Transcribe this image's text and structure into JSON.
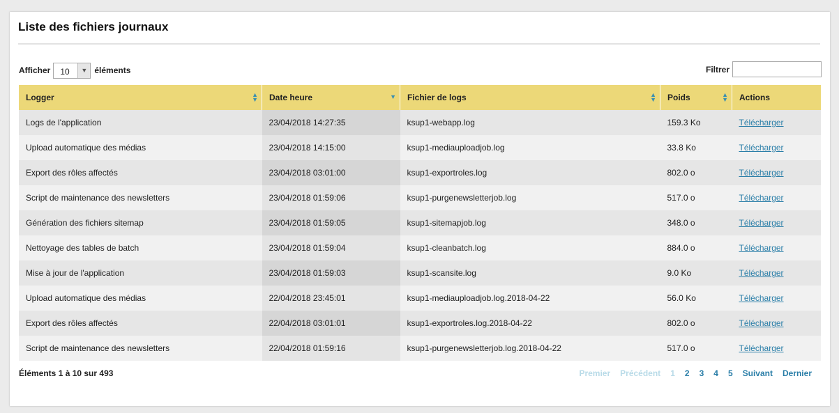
{
  "page_title": "Liste des fichiers journaux",
  "length_control": {
    "prefix": "Afficher",
    "value": "10",
    "suffix": "éléments"
  },
  "filter": {
    "label": "Filtrer",
    "value": ""
  },
  "table": {
    "columns": [
      "Logger",
      "Date heure",
      "Fichier de logs",
      "Poids",
      "Actions"
    ],
    "rows": [
      {
        "logger": "Logs de l'application",
        "date": "23/04/2018 14:27:35",
        "file": "ksup1-webapp.log",
        "size": "159.3 Ko",
        "action": "Télécharger"
      },
      {
        "logger": "Upload automatique des médias",
        "date": "23/04/2018 14:15:00",
        "file": "ksup1-mediauploadjob.log",
        "size": "33.8 Ko",
        "action": "Télécharger"
      },
      {
        "logger": "Export des rôles affectés",
        "date": "23/04/2018 03:01:00",
        "file": "ksup1-exportroles.log",
        "size": "802.0 o",
        "action": "Télécharger"
      },
      {
        "logger": "Script de maintenance des newsletters",
        "date": "23/04/2018 01:59:06",
        "file": "ksup1-purgenewsletterjob.log",
        "size": "517.0 o",
        "action": "Télécharger"
      },
      {
        "logger": "Génération des fichiers sitemap",
        "date": "23/04/2018 01:59:05",
        "file": "ksup1-sitemapjob.log",
        "size": "348.0 o",
        "action": "Télécharger"
      },
      {
        "logger": "Nettoyage des tables de batch",
        "date": "23/04/2018 01:59:04",
        "file": "ksup1-cleanbatch.log",
        "size": "884.0 o",
        "action": "Télécharger"
      },
      {
        "logger": "Mise à jour de l'application",
        "date": "23/04/2018 01:59:03",
        "file": "ksup1-scansite.log",
        "size": "9.0 Ko",
        "action": "Télécharger"
      },
      {
        "logger": "Upload automatique des médias",
        "date": "22/04/2018 23:45:01",
        "file": "ksup1-mediauploadjob.log.2018-04-22",
        "size": "56.0 Ko",
        "action": "Télécharger"
      },
      {
        "logger": "Export des rôles affectés",
        "date": "22/04/2018 03:01:01",
        "file": "ksup1-exportroles.log.2018-04-22",
        "size": "802.0 o",
        "action": "Télécharger"
      },
      {
        "logger": "Script de maintenance des newsletters",
        "date": "22/04/2018 01:59:16",
        "file": "ksup1-purgenewsletterjob.log.2018-04-22",
        "size": "517.0 o",
        "action": "Télécharger"
      }
    ]
  },
  "info": "Éléments 1 à 10 sur 493",
  "pagination": {
    "first": "Premier",
    "previous": "Précédent",
    "pages": [
      "1",
      "2",
      "3",
      "4",
      "5"
    ],
    "next": "Suivant",
    "last": "Dernier"
  },
  "colors": {
    "header_bg": "#ecd878",
    "link": "#2a7ea8",
    "disabled_link": "#b9dbe8"
  }
}
